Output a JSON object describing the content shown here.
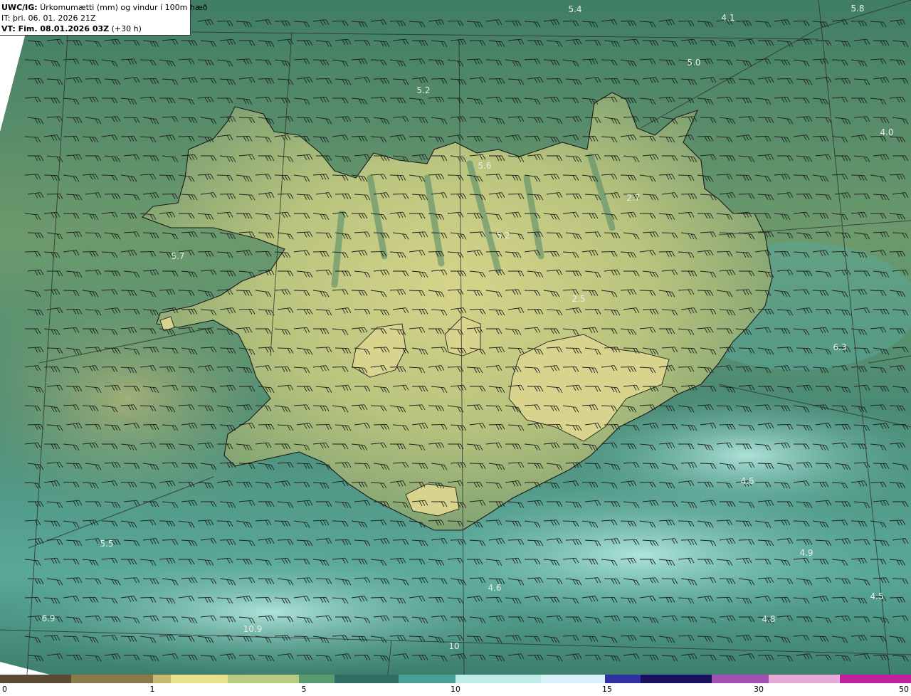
{
  "header": {
    "product": "UWC/IG:",
    "description": "Úrkomumætti (mm) og vindur í 100m hæð",
    "issue_time": "IT: þri. 06. 01. 2026 21Z",
    "valid_prefix": "VT: Fim. 08.01.2026 03Z",
    "valid_suffix": "(+30 h)"
  },
  "map_values": [
    {
      "text": "5.4",
      "id": "v1"
    },
    {
      "text": "4.1",
      "id": "v2"
    },
    {
      "text": "5.8",
      "id": "v3"
    },
    {
      "text": "5.0",
      "id": "v4"
    },
    {
      "text": "5.2",
      "id": "v5"
    },
    {
      "text": "4.0",
      "id": "v6"
    },
    {
      "text": "5.6",
      "id": "v7"
    },
    {
      "text": "2.7",
      "id": "v8"
    },
    {
      "text": "5.2",
      "id": "v9"
    },
    {
      "text": "5.7",
      "id": "v10"
    },
    {
      "text": "2.5",
      "id": "v11"
    },
    {
      "text": "6.3",
      "id": "v12"
    },
    {
      "text": "4.6",
      "id": "v13"
    },
    {
      "text": "5.5",
      "id": "v14"
    },
    {
      "text": "4.9",
      "id": "v15"
    },
    {
      "text": "4.6",
      "id": "v16"
    },
    {
      "text": "4.5",
      "id": "v17"
    },
    {
      "text": "6.9",
      "id": "v18"
    },
    {
      "text": "10.9",
      "id": "v19"
    },
    {
      "text": "4.8",
      "id": "v20"
    },
    {
      "text": "10",
      "id": "v21"
    }
  ],
  "colorbar": {
    "ticks": [
      "0",
      "1",
      "5",
      "10",
      "15",
      "30",
      "50"
    ],
    "colors": [
      "#5a4a35",
      "#8a7a4a",
      "#c8b870",
      "#e8e08a",
      "#b8cc80",
      "#5a9a70",
      "#2e6e62",
      "#4aa098",
      "#bfeee8",
      "#d8f0f8",
      "#3030a0",
      "#1a1060",
      "#a050b0",
      "#e8a8d8",
      "#c020a0"
    ]
  }
}
